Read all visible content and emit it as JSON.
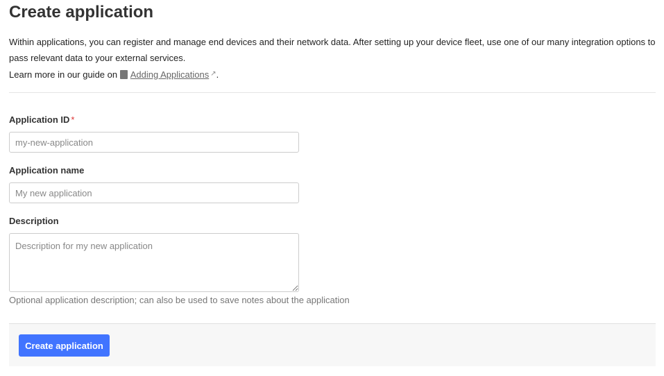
{
  "page": {
    "title": "Create application",
    "intro": "Within applications, you can register and manage end devices and their network data. After setting up your device fleet, use one of our many integration options to pass relevant data to your external services.",
    "learn_more_prefix": "Learn more in our guide on",
    "learn_more_link": "Adding Applications",
    "learn_more_suffix": "."
  },
  "form": {
    "app_id": {
      "label": "Application ID",
      "required_mark": "*",
      "placeholder": "my-new-application",
      "value": ""
    },
    "app_name": {
      "label": "Application name",
      "placeholder": "My new application",
      "value": ""
    },
    "description": {
      "label": "Description",
      "placeholder": "Description for my new application",
      "hint": "Optional application description; can also be used to save notes about the application"
    },
    "submit_label": "Create application"
  },
  "colors": {
    "primary": "#4174ff",
    "required": "#dd3333"
  }
}
